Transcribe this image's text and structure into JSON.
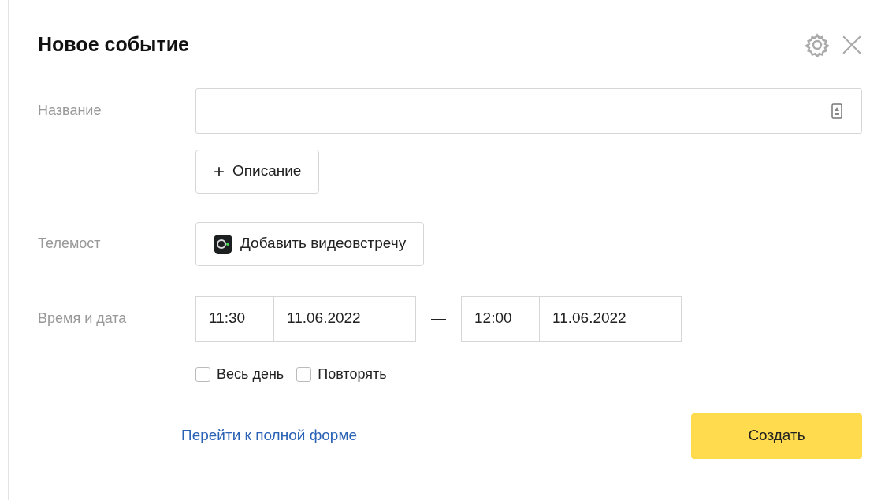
{
  "dialog": {
    "title": "Новое событие"
  },
  "name_row": {
    "label": "Название",
    "description_button": "Описание",
    "description_button_icon": "+"
  },
  "telemost_row": {
    "label": "Телемост",
    "button": "Добавить видеовстречу"
  },
  "time_row": {
    "label": "Время и дата",
    "start_time": "11:30",
    "start_date": "11.06.2022",
    "separator": "—",
    "end_time": "12:00",
    "end_date": "11.06.2022"
  },
  "options": [
    {
      "label": "Весь день",
      "checked": false
    },
    {
      "label": "Повторять",
      "checked": false
    }
  ],
  "footer": {
    "link": "Перейти к полной форме",
    "create_button": "Создать"
  }
}
